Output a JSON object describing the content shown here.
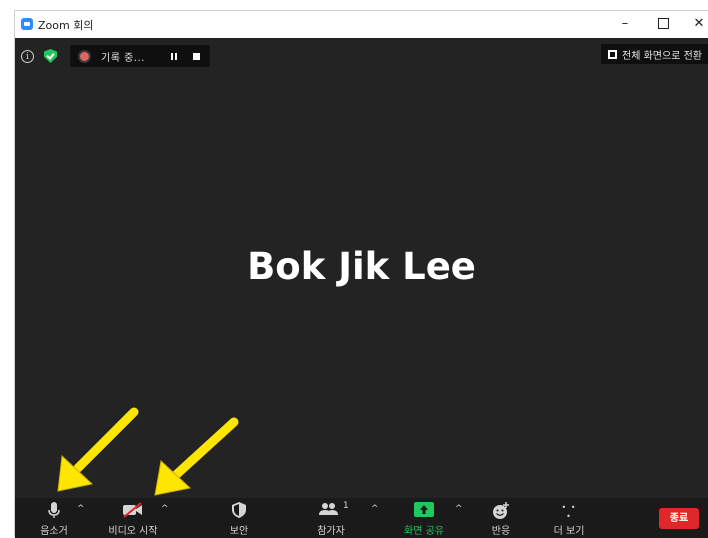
{
  "window": {
    "title": "Zoom 회의",
    "minimize_glyph": "–",
    "close_glyph": "✕"
  },
  "top_bar": {
    "info_glyph": "i",
    "recording_label": "기록 중...",
    "fullscreen_label": "전체 화면으로 전환"
  },
  "participant": {
    "name": "Bok Jik Lee"
  },
  "toolbar": {
    "mute_label": "음소거",
    "video_label": "비디오 시작",
    "security_label": "보안",
    "participants_label": "참가자",
    "participants_count": "1",
    "share_label": "화면 공유",
    "reactions_label": "반응",
    "more_label": "더 보기",
    "more_glyph": "• • •",
    "end_label": "종료",
    "caret_glyph": "^"
  },
  "colors": {
    "meeting_bg": "#232323",
    "toolbar_bg": "#1a1a1a",
    "share_green": "#22c55e",
    "end_red": "#e02828",
    "annotation_arrow": "#ffe600"
  },
  "icons": {
    "info": "info-icon",
    "security_status": "shield-check-icon",
    "record": "record-dot-icon",
    "pause": "pause-icon",
    "stop": "stop-icon",
    "fullscreen": "fullscreen-icon",
    "mic": "microphone-icon",
    "video_off": "video-off-icon",
    "security": "shield-icon",
    "participants": "people-icon",
    "share": "share-screen-icon",
    "reactions": "emoji-plus-icon",
    "more": "ellipsis-icon"
  }
}
